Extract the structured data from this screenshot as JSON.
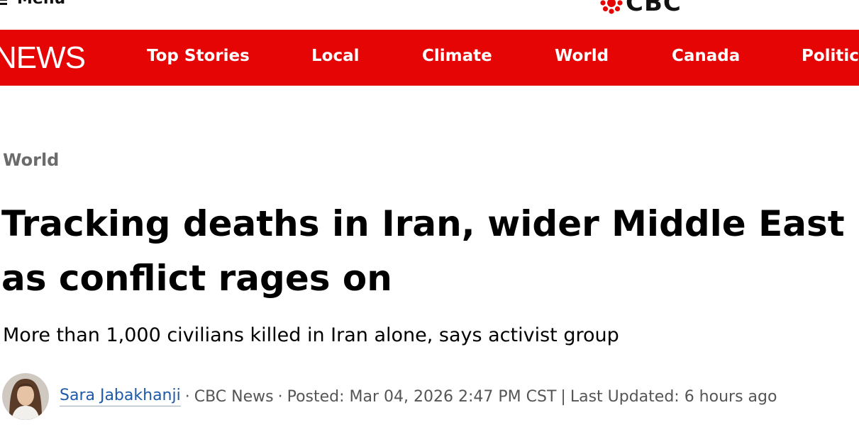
{
  "header": {
    "menu_label": "Menu",
    "logo_text": "CBC"
  },
  "nav": {
    "brand": "NEWS",
    "items": [
      {
        "label": "Top Stories"
      },
      {
        "label": "Local"
      },
      {
        "label": "Climate"
      },
      {
        "label": "World"
      },
      {
        "label": "Canada"
      },
      {
        "label": "Politics"
      }
    ],
    "background_color": "#e60505"
  },
  "article": {
    "section": "World",
    "headline_line1": "Tracking deaths in Iran, wider Middle East",
    "headline_line2": "as conflict rages on",
    "deck": "More than 1,000 civilians killed in Iran alone, says activist group",
    "author": "Sara Jabakhanji",
    "outlet": "CBC News",
    "posted": "Posted: Mar 04, 2026 2:47 PM CST",
    "updated": "Last Updated: 6 hours ago"
  }
}
